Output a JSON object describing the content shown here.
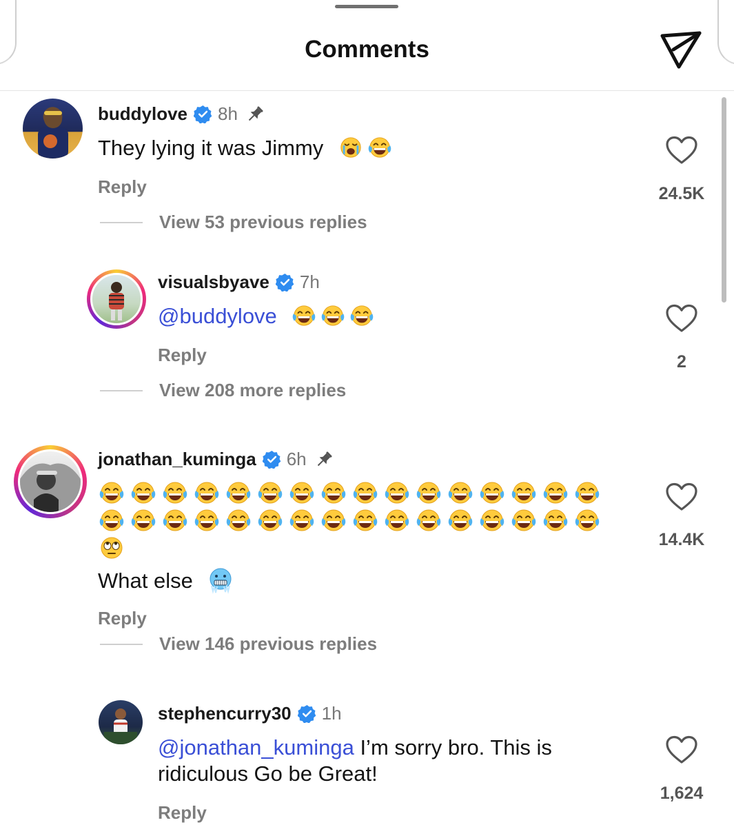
{
  "header": {
    "title": "Comments"
  },
  "comments": [
    {
      "username": "buddylove",
      "time": "8h",
      "text": "They lying it was Jimmy",
      "reply_label": "Reply",
      "likes": "24.5K",
      "thread_label": "View 53 previous replies"
    },
    {
      "username": "visualsbyave",
      "time": "7h",
      "mention": "@buddylove",
      "reply_label": "Reply",
      "likes": "2",
      "thread_label": "View 208 more replies"
    },
    {
      "username": "jonathan_kuminga",
      "time": "6h",
      "laugh_count": 32,
      "text": "What else",
      "reply_label": "Reply",
      "likes": "14.4K",
      "thread_label": "View 146 previous replies"
    },
    {
      "username": "stephencurry30",
      "time": "1h",
      "mention": "@jonathan_kuminga",
      "text_line1": " I’m sorry bro. This is",
      "text_line2": "ridiculous Go be Great!",
      "reply_label": "Reply",
      "likes": "1,624"
    }
  ],
  "colors": {
    "mention": "#3a4fd6",
    "verified": "#2f8cf0",
    "secondary_text": "#7d7d7d"
  }
}
